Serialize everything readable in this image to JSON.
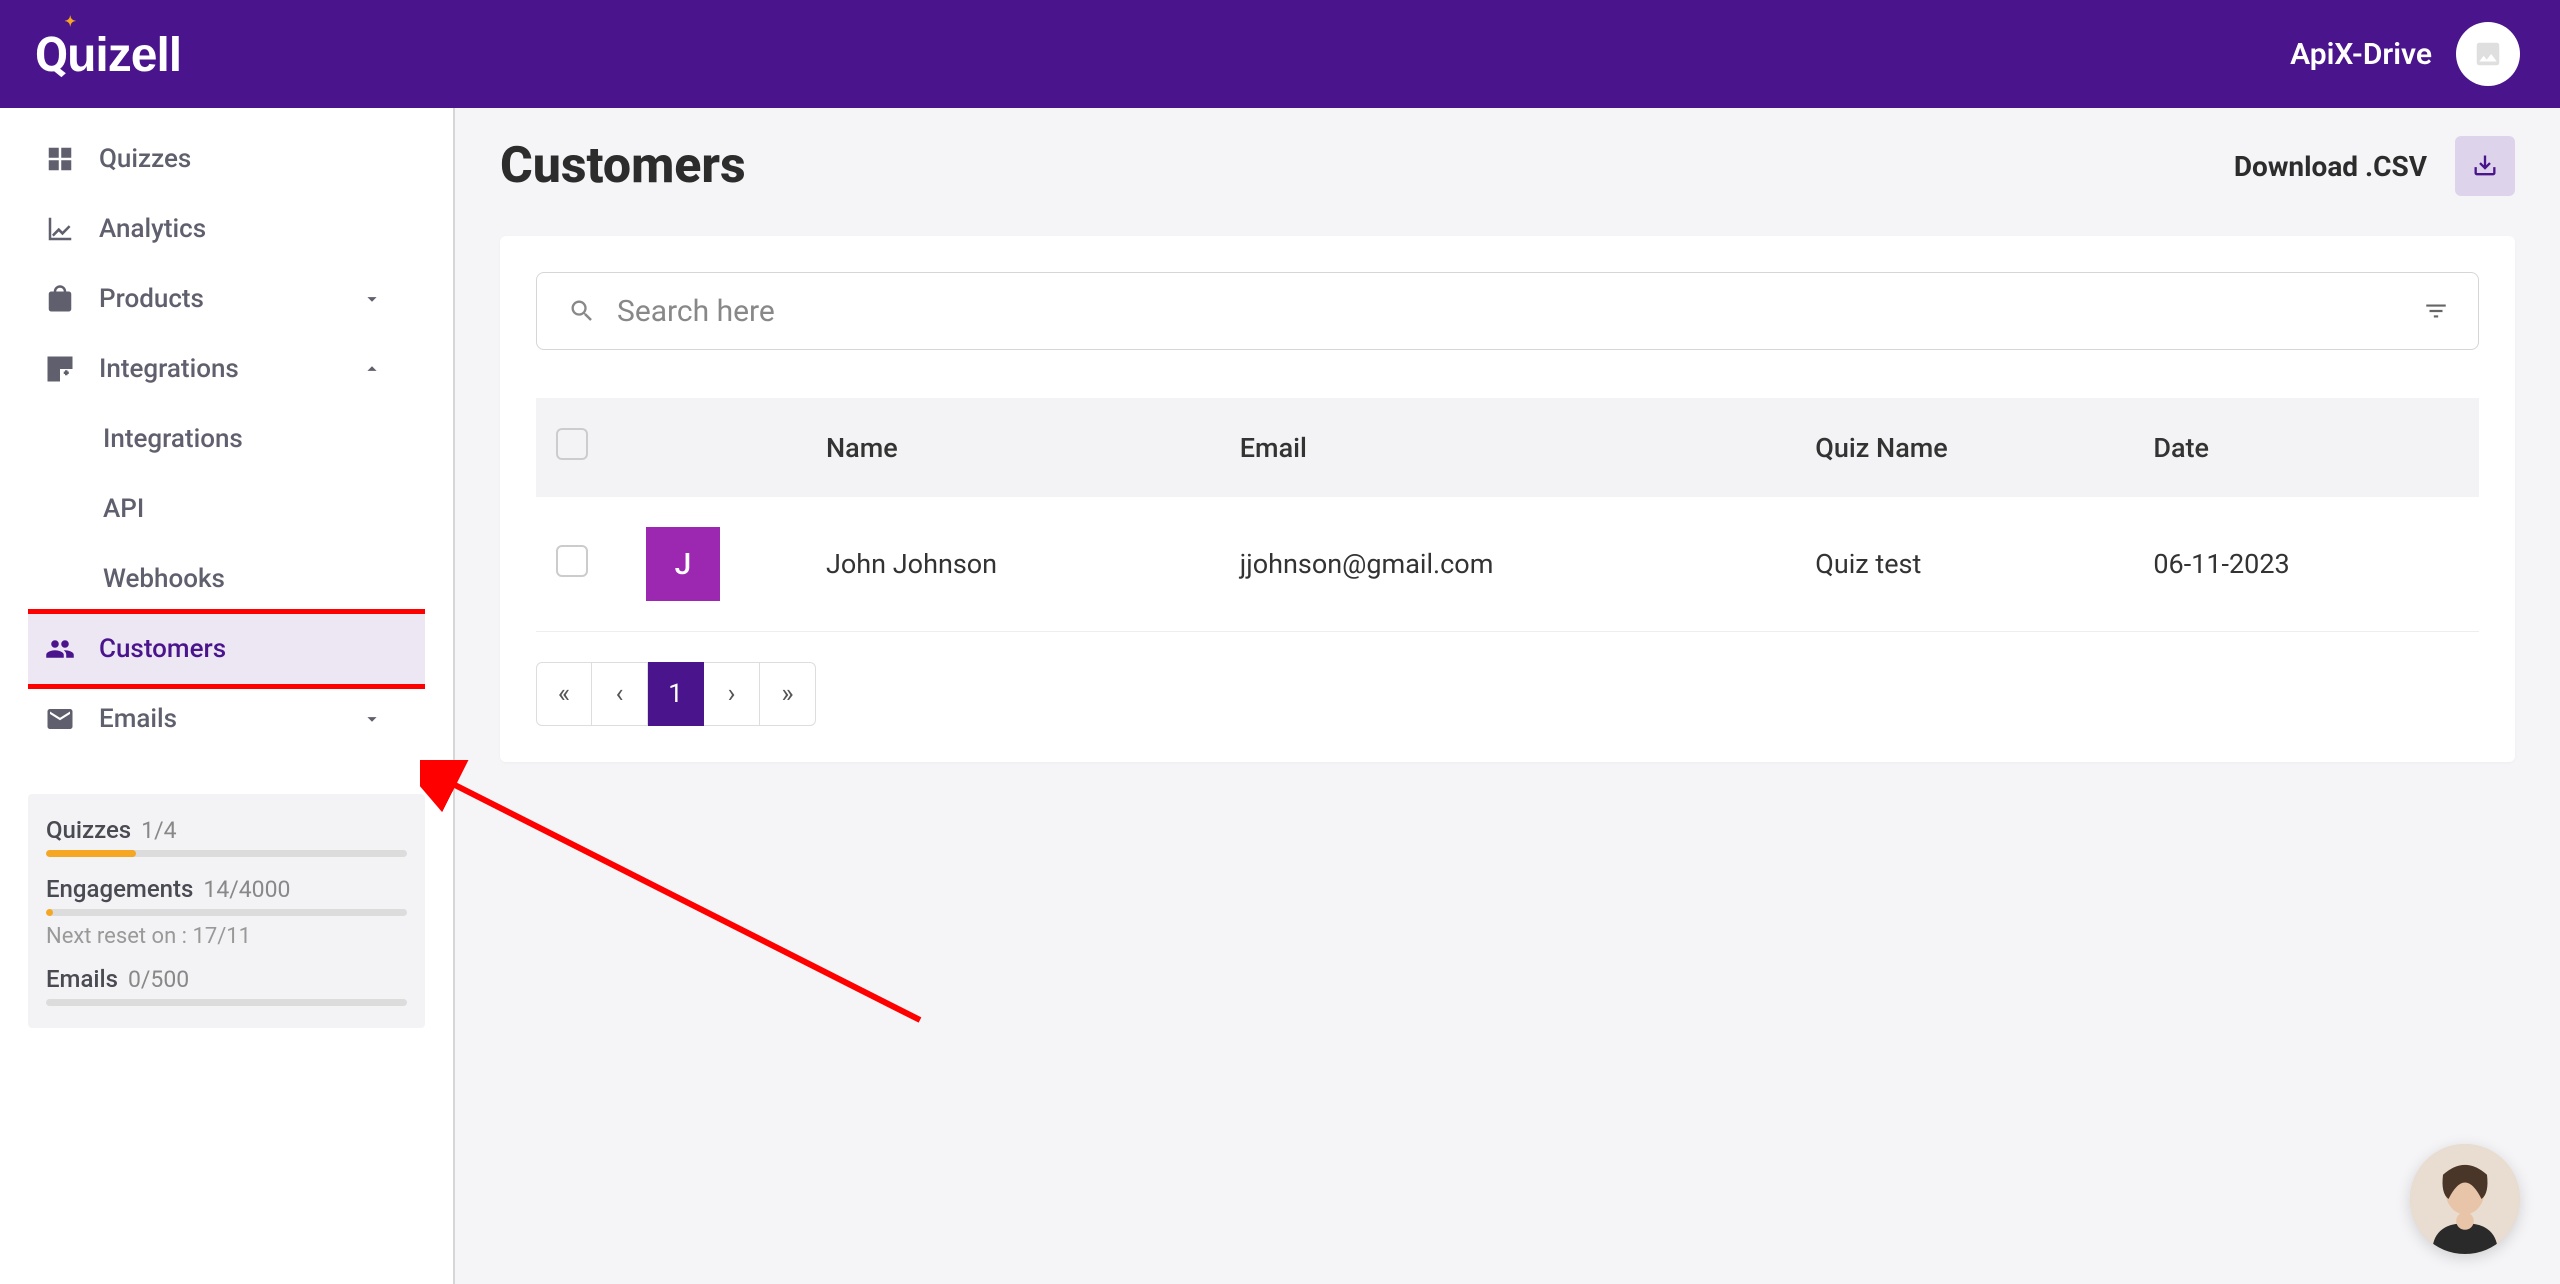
{
  "header": {
    "logo_text": "Quizell",
    "brand_name": "ApiX-Drive"
  },
  "sidebar": {
    "items": [
      {
        "label": "Quizzes"
      },
      {
        "label": "Analytics"
      },
      {
        "label": "Products"
      },
      {
        "label": "Integrations"
      },
      {
        "label": "Integrations"
      },
      {
        "label": "API"
      },
      {
        "label": "Webhooks"
      },
      {
        "label": "Customers"
      },
      {
        "label": "Emails"
      }
    ],
    "usage": {
      "quizzes_label": "Quizzes",
      "quizzes_val": "1/4",
      "quizzes_fill_pct": 25,
      "quizzes_fill_color": "#f5a623",
      "engagements_label": "Engagements",
      "engagements_val": "14/4000",
      "reset_note": "Next reset on : 17/11",
      "engagements_fill_pct": 2,
      "engagements_fill_color": "#f5a623",
      "emails_label": "Emails",
      "emails_val": "0/500",
      "emails_fill_pct": 0,
      "emails_fill_color": "#f5a623"
    }
  },
  "main": {
    "title": "Customers",
    "download_label": "Download .CSV",
    "search_placeholder": "Search here",
    "columns": {
      "name": "Name",
      "email": "Email",
      "quiz": "Quiz Name",
      "date": "Date"
    },
    "rows": [
      {
        "initial": "J",
        "name": "John Johnson",
        "email": "jjohnson@gmail.com",
        "quiz": "Quiz test",
        "date": "06-11-2023"
      }
    ],
    "pagination": {
      "first": "«",
      "prev": "‹",
      "current": "1",
      "next": "›",
      "last": "»"
    }
  }
}
